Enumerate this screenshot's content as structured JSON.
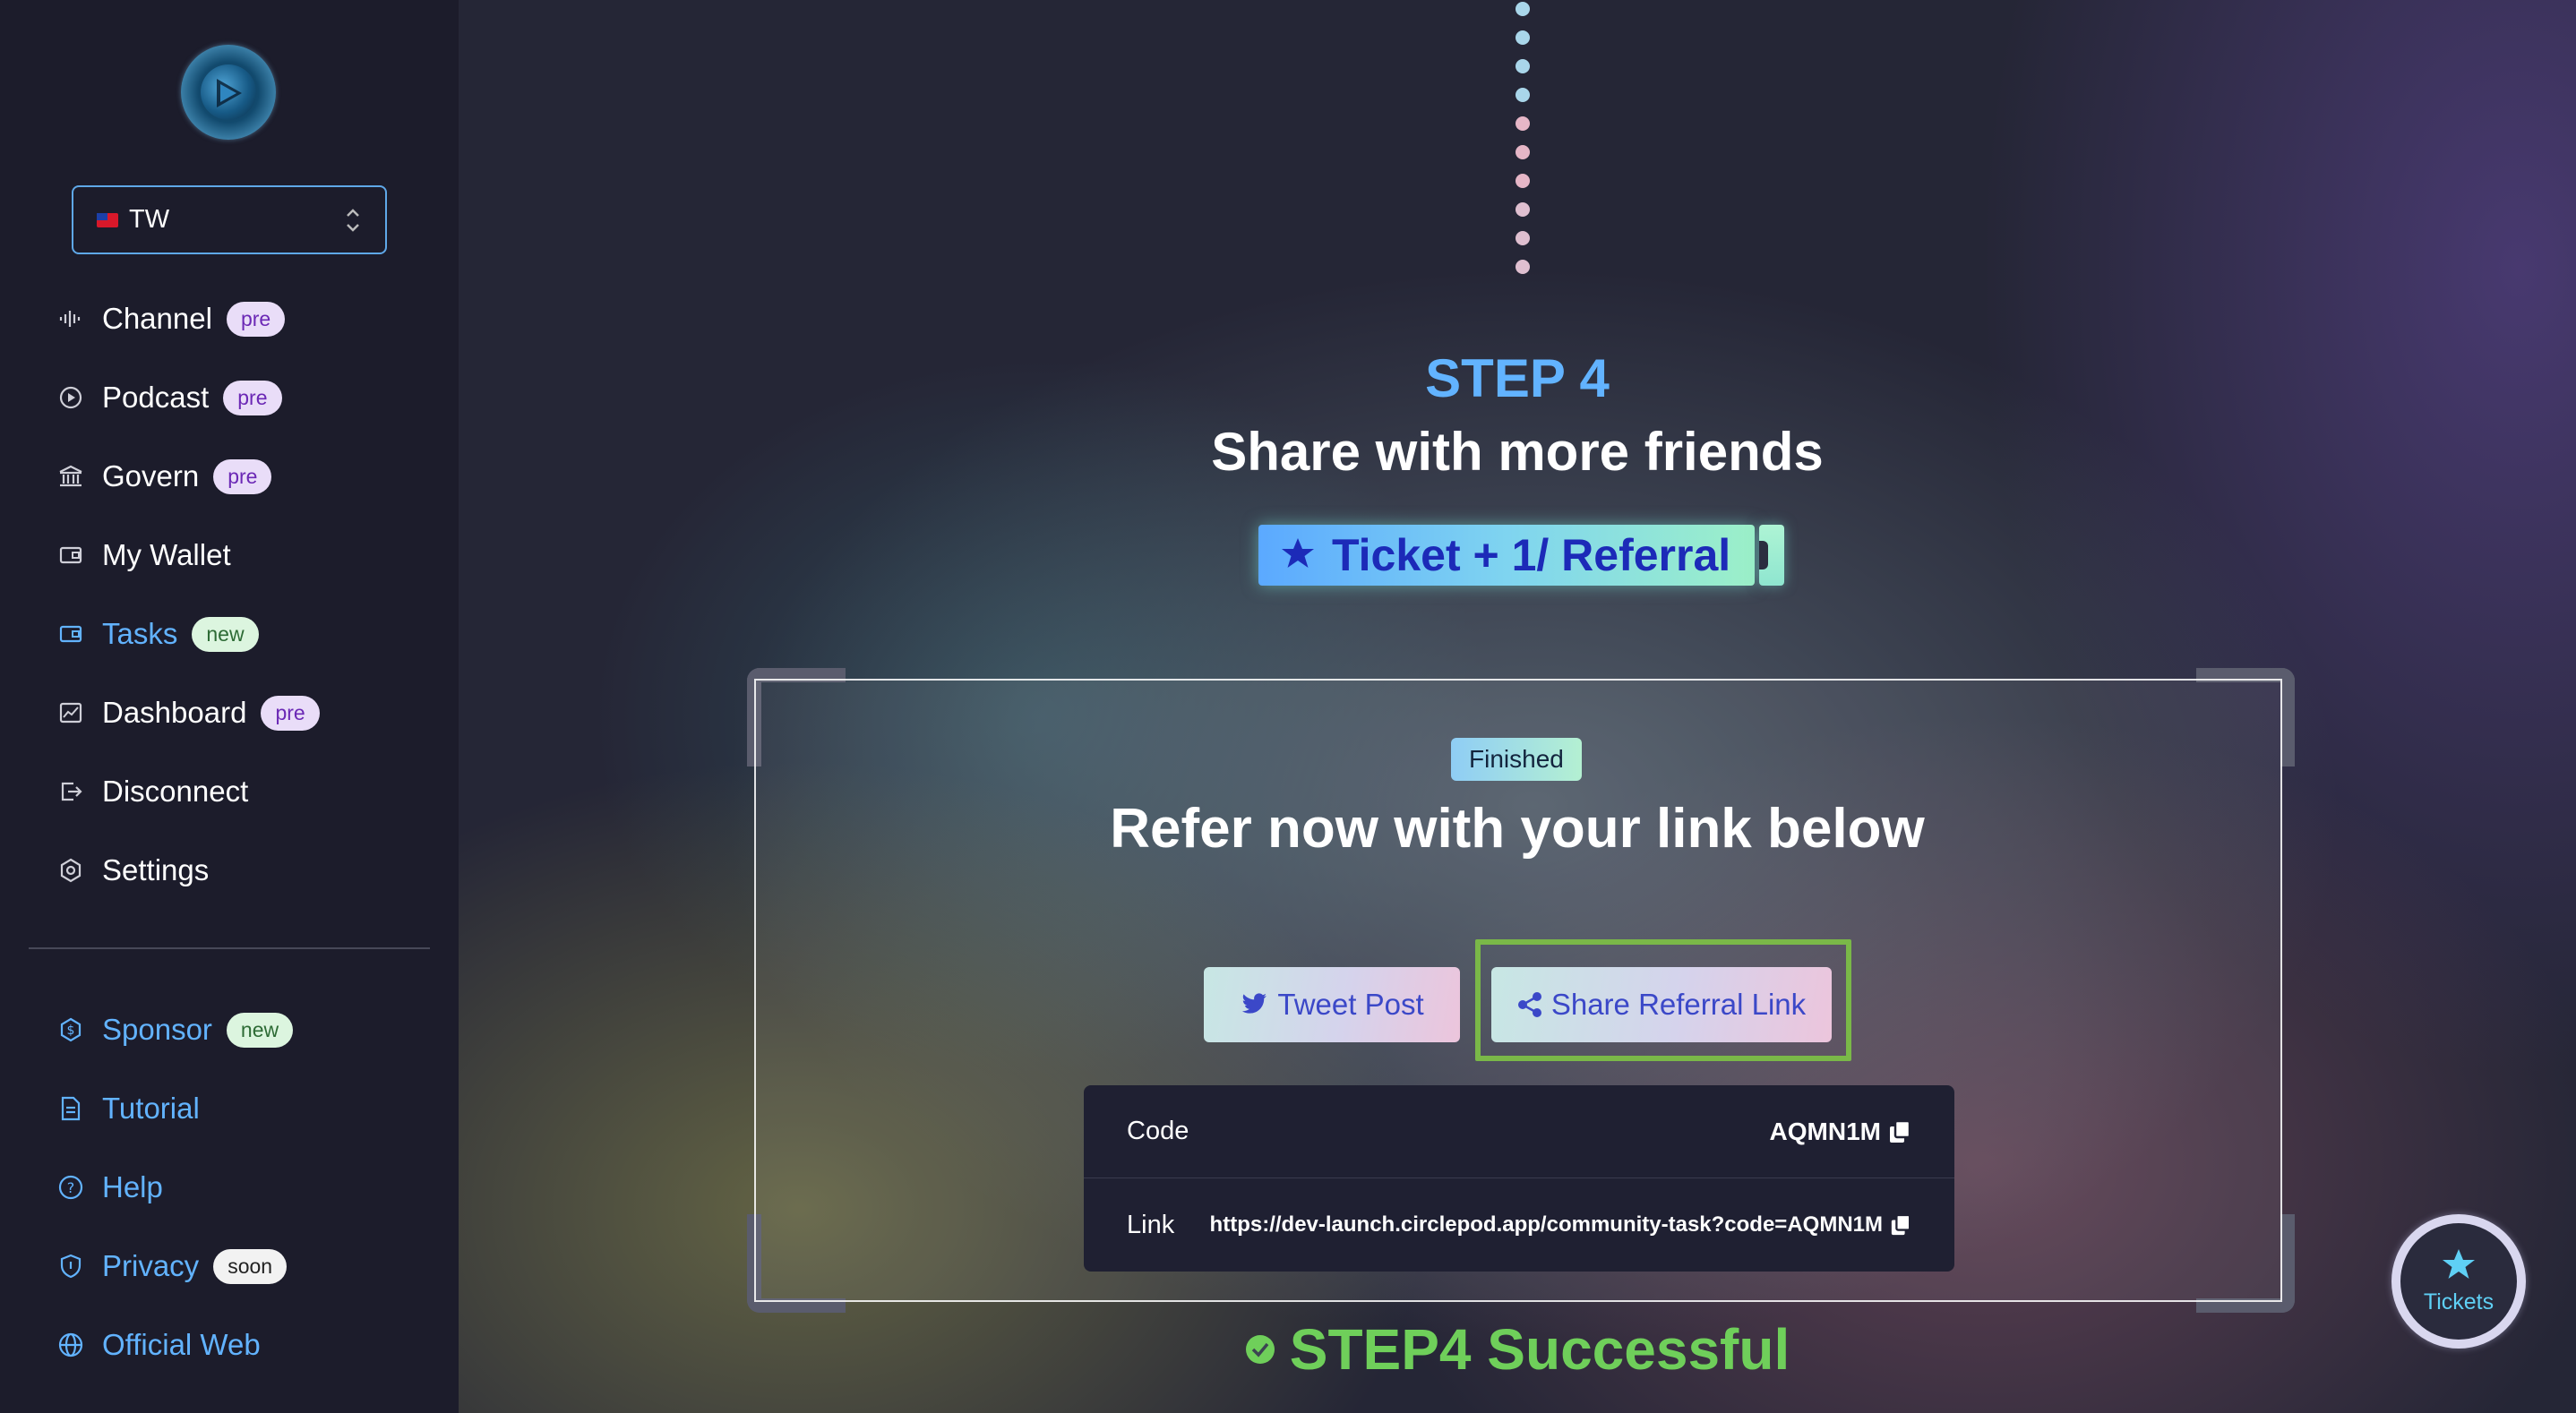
{
  "sidebar": {
    "region": {
      "value": "TW",
      "flag": "taiwan-flag"
    },
    "items": [
      {
        "label": "Channel",
        "icon": "audio-wave-icon",
        "badge": "pre"
      },
      {
        "label": "Podcast",
        "icon": "play-circle-icon",
        "badge": "pre"
      },
      {
        "label": "Govern",
        "icon": "bank-icon",
        "badge": "pre"
      },
      {
        "label": "My Wallet",
        "icon": "wallet-icon",
        "badge": ""
      },
      {
        "label": "Tasks",
        "icon": "wallet-icon",
        "badge": "new",
        "active": true
      },
      {
        "label": "Dashboard",
        "icon": "chart-icon",
        "badge": "pre"
      },
      {
        "label": "Disconnect",
        "icon": "logout-icon",
        "badge": ""
      },
      {
        "label": "Settings",
        "icon": "gear-icon",
        "badge": ""
      }
    ],
    "bottom_items": [
      {
        "label": "Sponsor",
        "icon": "dollar-circle-icon",
        "badge": "new"
      },
      {
        "label": "Tutorial",
        "icon": "document-icon",
        "badge": ""
      },
      {
        "label": "Help",
        "icon": "question-circle-icon",
        "badge": ""
      },
      {
        "label": "Privacy",
        "icon": "shield-icon",
        "badge": "soon"
      },
      {
        "label": "Official Web",
        "icon": "globe-icon",
        "badge": ""
      }
    ]
  },
  "main": {
    "step_label": "STEP 4",
    "step_title": "Share with more friends",
    "ticket_reward": "Ticket + 1/ Referral",
    "card": {
      "status_badge": "Finished",
      "title": "Refer now with your link below",
      "tweet_button": "Tweet Post",
      "share_button": "Share Referral Link",
      "code_label": "Code",
      "code_value": "AQMN1M",
      "link_label": "Link",
      "link_value": "https://dev-launch.circlepod.app/community-task?code=AQMN1M"
    },
    "success_text": "STEP4 Successful",
    "tickets_button": "Tickets"
  },
  "colors": {
    "accent": "#62b3ff",
    "success": "#6fcf5a",
    "highlight": "#7ab848",
    "sidebar_bg": "#1c1c2b"
  }
}
